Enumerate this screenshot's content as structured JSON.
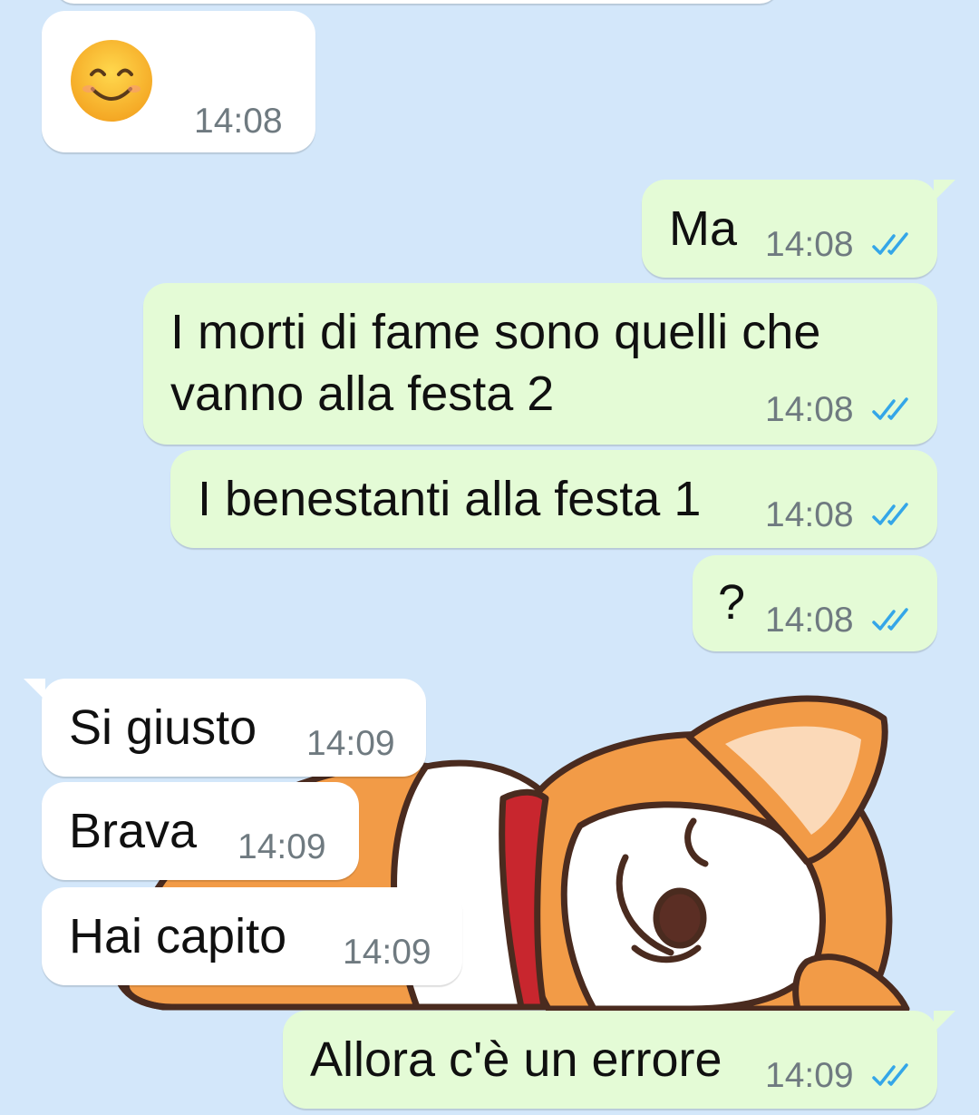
{
  "colors": {
    "background": "#d3e7fa",
    "incoming_bubble": "#ffffff",
    "outgoing_bubble": "#e4fbd6",
    "time_text": "#6f7a80",
    "read_ticks": "#34a6e8"
  },
  "wallpaper": {
    "icon": "sleeping-corgi-sticker"
  },
  "messages": [
    {
      "direction": "incoming",
      "icon": "smiling-face-emoji",
      "text": "",
      "time": "14:08"
    },
    {
      "direction": "outgoing",
      "text": "Ma",
      "time": "14:08",
      "status_icon": "double-check-read-icon"
    },
    {
      "direction": "outgoing",
      "lines": [
        "I morti di fame sono quelli che",
        "vanno alla festa 2"
      ],
      "time": "14:08",
      "status_icon": "double-check-read-icon"
    },
    {
      "direction": "outgoing",
      "text": "I benestanti alla festa 1",
      "time": "14:08",
      "status_icon": "double-check-read-icon"
    },
    {
      "direction": "outgoing",
      "text": "?",
      "time": "14:08",
      "status_icon": "double-check-read-icon"
    },
    {
      "direction": "incoming",
      "text": "Si giusto",
      "time": "14:09"
    },
    {
      "direction": "incoming",
      "text": "Brava",
      "time": "14:09"
    },
    {
      "direction": "incoming",
      "text": "Hai capito",
      "time": "14:09"
    },
    {
      "direction": "outgoing",
      "text": "Allora c'è un errore",
      "time": "14:09",
      "status_icon": "double-check-read-icon"
    }
  ]
}
